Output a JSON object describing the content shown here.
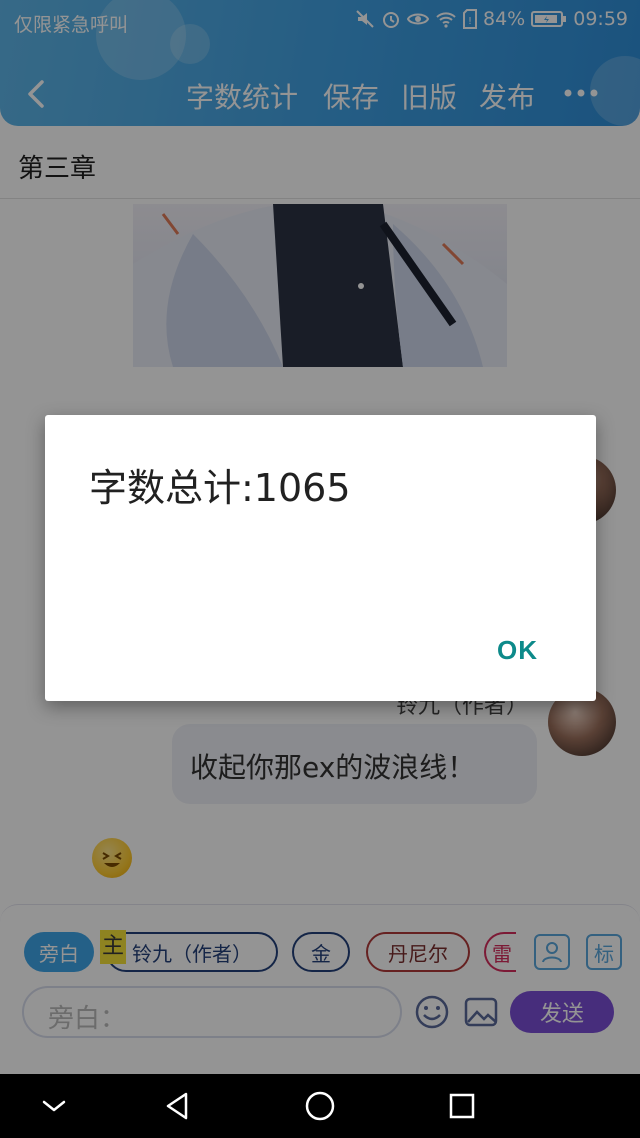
{
  "status_bar": {
    "carrier": "仅限紧急呼叫",
    "battery": "84%",
    "time": "09:59",
    "icons": [
      "mute-icon",
      "alarm-icon",
      "eye-icon",
      "wifi-icon",
      "sim-icon",
      "battery-icon"
    ]
  },
  "toolbar": {
    "back_icon": "chevron-left-icon",
    "word_count": "字数统计",
    "save": "保存",
    "old_version": "旧版",
    "publish": "发布",
    "more_icon": "more-dots-icon"
  },
  "content": {
    "chapter_title": "第三章",
    "author_tag": "铃九（作者）",
    "message": "收起你那ex的波浪线！"
  },
  "input_panel": {
    "roles": [
      "旁白",
      "铃九（作者）",
      "金",
      "丹尼尔",
      "雷"
    ],
    "master_marker": "主",
    "person_icon": "person-icon",
    "tag_button": "标",
    "placeholder": "旁白：",
    "emoji_icon": "smiley-icon",
    "image_icon": "image-icon",
    "send": "发送"
  },
  "dialog": {
    "message": "字数总计:1065",
    "ok": "OK"
  },
  "nav_bar": {
    "icons": [
      "chevron-down-icon",
      "back-triangle-icon",
      "home-circle-icon",
      "recents-square-icon"
    ]
  },
  "colors": {
    "header": "#3fa0e3",
    "dialog_accent": "#0d8a8a",
    "send_button": "#7a4fd6"
  }
}
